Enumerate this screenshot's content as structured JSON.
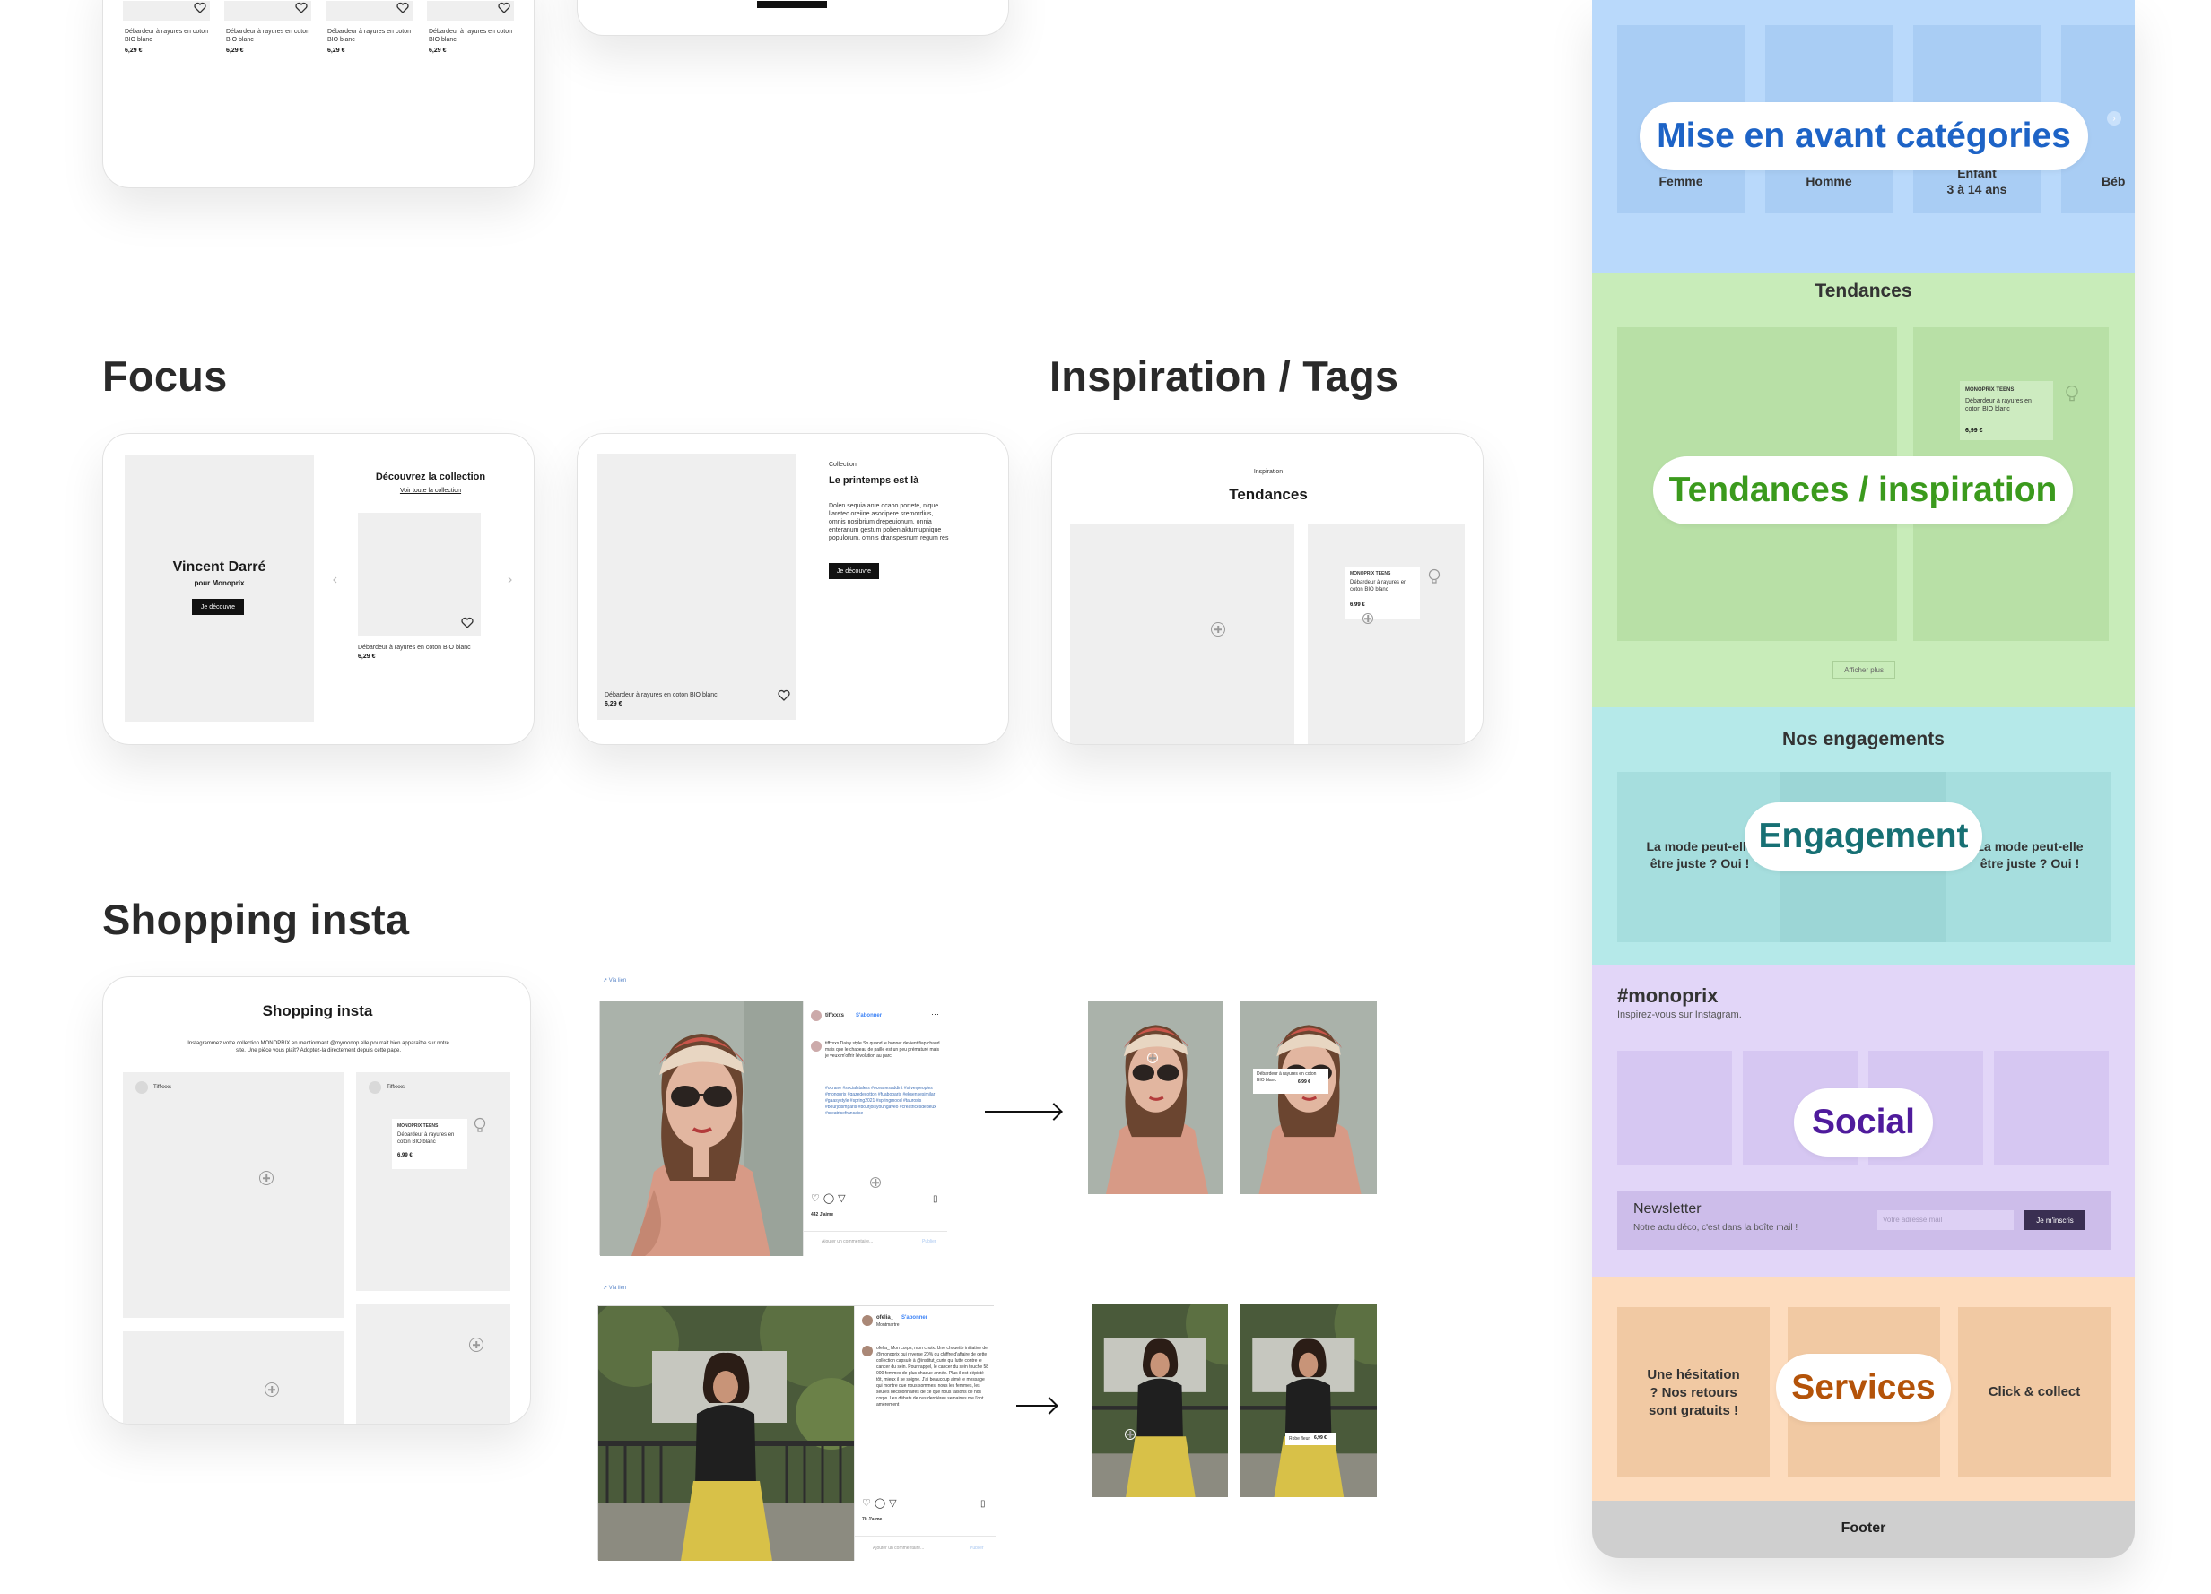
{
  "top_card": {
    "products": [
      {
        "label": "Débardeur à rayures en coton BIO blanc",
        "price": "6,29 €"
      },
      {
        "label": "Débardeur à rayures en coton BIO blanc",
        "price": "6,29 €"
      },
      {
        "label": "Débardeur à rayures en coton BIO blanc",
        "price": "6,29 €"
      },
      {
        "label": "Débardeur à rayures en coton BIO blanc",
        "price": "6,29 €"
      }
    ]
  },
  "focus": {
    "title": "Focus",
    "card1": {
      "hero_title": "Vincent Darré",
      "hero_subtitle": "pour Monoprix",
      "hero_button": "Je découvre",
      "collection_title": "Découvrez la collection",
      "collection_link": "Voir toute la collection",
      "product_label": "Débardeur à rayures en coton BIO blanc",
      "product_price": "6,29 €"
    },
    "card2": {
      "eyebrow": "Collection",
      "title": "Le printemps est là",
      "body": "Dolen sequia ante ocabo portete, nique liaretec oreiine asocipere sremordius, omnis nosibrium drepeuionum, onnia enteranum gestum pobenlaktumupnique populorum. omnis dranspesnum regum res",
      "button": "Je découvre",
      "product_label": "Débardeur à rayures en coton BIO blanc",
      "product_price": "6,29 €"
    }
  },
  "inspiration": {
    "title": "Inspiration / Tags",
    "eyebrow": "Inspiration",
    "heading": "Tendances",
    "tag_brand": "MONOPRIX TEENS",
    "tag_label": "Débardeur à rayures en coton BIO blanc",
    "tag_price": "6,99 €"
  },
  "shopping": {
    "title": "Shopping insta",
    "card_heading": "Shopping insta",
    "card_intro": "Instagrammez votre collection MONOPRIX en mentionnant @mymonop elle pourrait bien apparaître sur notre site. Une pièce vous plaît? Adoptez-la directement depuis cette page.",
    "user_left": "Tiffxxxs",
    "user_right": "Tiffxxxs",
    "tag_brand": "MONOPRIX TEENS",
    "tag_label": "Débardeur à rayures en coton BIO blanc",
    "tag_price": "6,99 €",
    "post1": {
      "link": "↗ Via lien",
      "user": "tiffxxxs",
      "follow": "S'abonner",
      "caption": "tiffxxxs Daisy style So quand le bonnet devient fiap chaud mais que le chapeau de paille est un peu prématuré mais je veux m'offrir l'évolution au parc",
      "hashtags": "#ocrane #socialstalers #oceanesaddint #silverpeoples #monoprix #gazedecotton #fuaboparis #eksensesimilar #gaasystyle #spring2021 #springmood #taurosis #bourjoismparis #bourjoisyoungaveo #creatricesdedeux #creatricefrancaise",
      "likes": "442 J'aime",
      "comment_placeholder": "Ajouter un commentaire...",
      "publish": "Publier",
      "tag_label": "Débardeur à rayures en coton BIO blanc",
      "tag_price": "6,99 €"
    },
    "post2": {
      "link": "↗ Via lien",
      "user": "ofelia_",
      "follow": "S'abonner",
      "location": "Montmartre",
      "caption": "ofelia_ Mon corps, mon choix. Une chouette initiative de @monoprix qui reverse 20% du chiffre d'affaire de cette collection capsule à @institut_curie qui lutte contre le cancer du sein. Pour rappel, le cancer du sein touche 58 000 femmes de plus chaque année. Plus il est dépisté tôt, mieux il se soigne. J'ai beaucoup aimé le message qui montre que nous sommes, nous les femmes, les seules décisionnaires de ce que nous faisons de nos corps. Les débats de ces dernières semaines me l'ont amèrement",
      "likes": "70 J'aime",
      "comment_placeholder": "Ajouter un commentaire...",
      "publish": "Publier",
      "tag_label": "Robe fleur",
      "tag_price": "6,99 €"
    }
  },
  "sidebar": {
    "categories": {
      "pill": "Mise en avant catégories",
      "items": [
        "Femme",
        "Homme",
        "Enfant\n3 à 14 ans",
        "Béb"
      ]
    },
    "trends": {
      "heading": "Tendances",
      "pill": "Tendances / inspiration",
      "tag_brand": "MONOPRIX TEENS",
      "tag_label": "Débardeur à rayures en coton BIO blanc",
      "tag_price": "6,99 €",
      "show_more": "Afficher plus"
    },
    "engagement": {
      "heading": "Nos engagements",
      "pill": "Engagement",
      "left_text": "La mode peut-elle\nêtre juste ? Oui !",
      "right_text": "La mode peut-elle\nêtre juste ? Oui !"
    },
    "social": {
      "heading": "#monoprix",
      "sub": "Inspirez-vous sur Instagram.",
      "pill": "Social",
      "newsletter_title": "Newsletter",
      "newsletter_text": "Notre actu déco, c'est dans la boîte mail !",
      "email_placeholder": "Votre adresse mail",
      "subscribe": "Je m'inscris"
    },
    "services": {
      "pill": "Services",
      "left": "Une hésitation\n? Nos retours\nsont gratuits !",
      "right": "Click & collect"
    },
    "footer": "Footer"
  },
  "colors": {
    "categories_bg": "#b9d9fb",
    "trends_bg": "#c8ecb9",
    "engagement_bg": "#b5e9e9",
    "social_bg": "#e2d6f8",
    "services_bg": "#fddcbe",
    "footer_bg": "#cfcfcf",
    "categories_text": "#1d63c6",
    "trends_text": "#3b9a1d",
    "engagement_text": "#177074",
    "social_text": "#4f1b9c",
    "services_text": "#b45309"
  }
}
